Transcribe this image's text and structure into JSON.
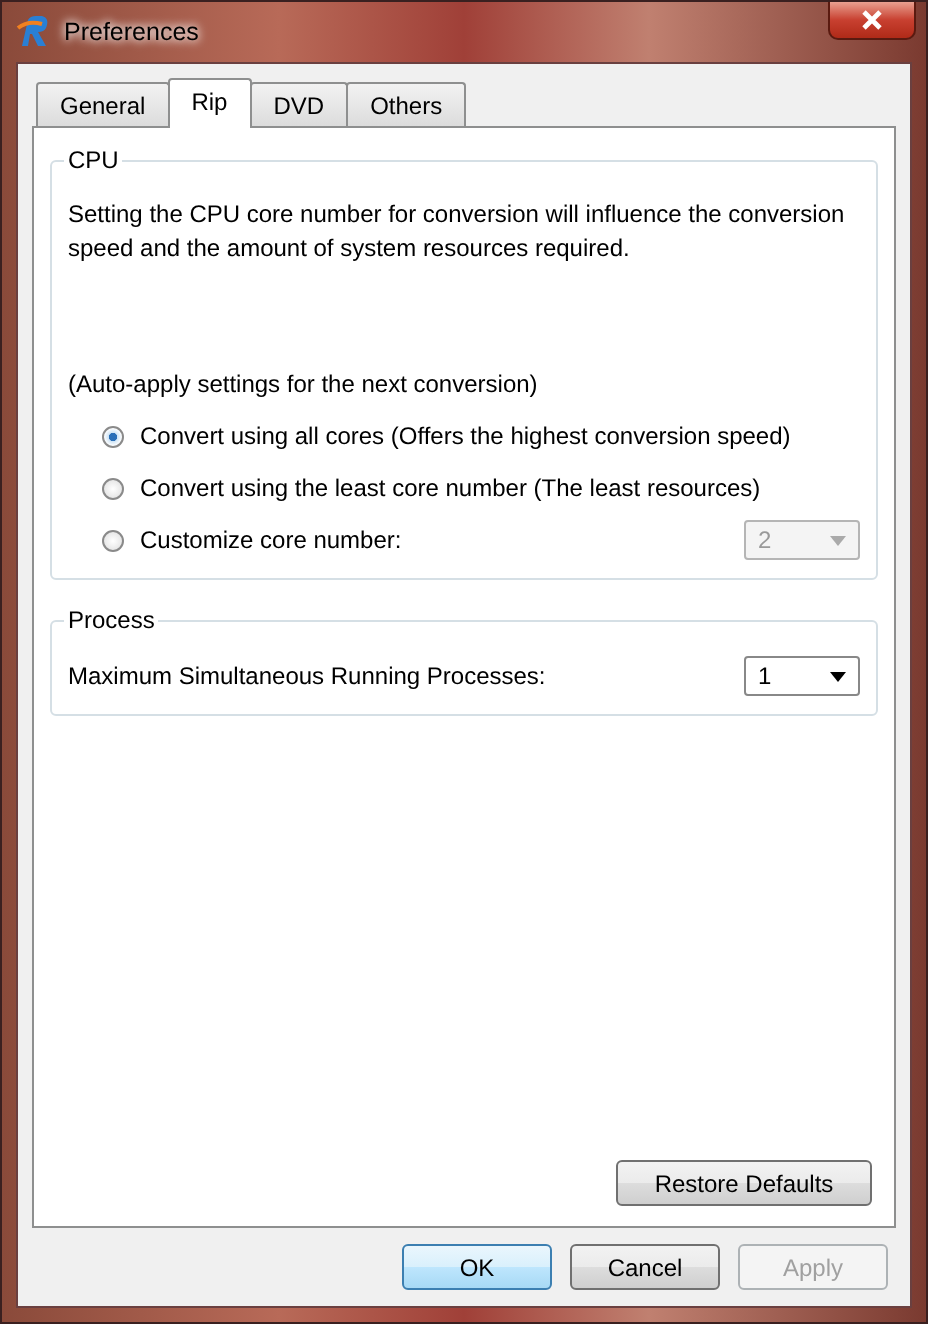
{
  "window": {
    "title": "Preferences"
  },
  "tabs": [
    {
      "label": "General",
      "selected": false
    },
    {
      "label": "Rip",
      "selected": true
    },
    {
      "label": "DVD",
      "selected": false
    },
    {
      "label": "Others",
      "selected": false
    }
  ],
  "cpu": {
    "title": "CPU",
    "description": "Setting the CPU core number for conversion will influence the conversion speed and the amount of system resources required.",
    "note": "(Auto-apply settings for the next conversion)",
    "options": [
      {
        "label": "Convert using all cores (Offers the highest conversion speed)",
        "selected": true
      },
      {
        "label": "Convert using the least core number (The least resources)",
        "selected": false
      },
      {
        "label": "Customize core number:",
        "selected": false
      }
    ],
    "core_select": {
      "value": "2",
      "disabled": true
    }
  },
  "process": {
    "title": "Process",
    "label": "Maximum Simultaneous Running Processes:",
    "select": {
      "value": "1",
      "disabled": false
    }
  },
  "restore_button": "Restore Defaults",
  "buttons": [
    {
      "label": "OK",
      "default": true,
      "disabled": false
    },
    {
      "label": "Cancel",
      "default": false,
      "disabled": false
    },
    {
      "label": "Apply",
      "default": false,
      "disabled": true
    }
  ]
}
